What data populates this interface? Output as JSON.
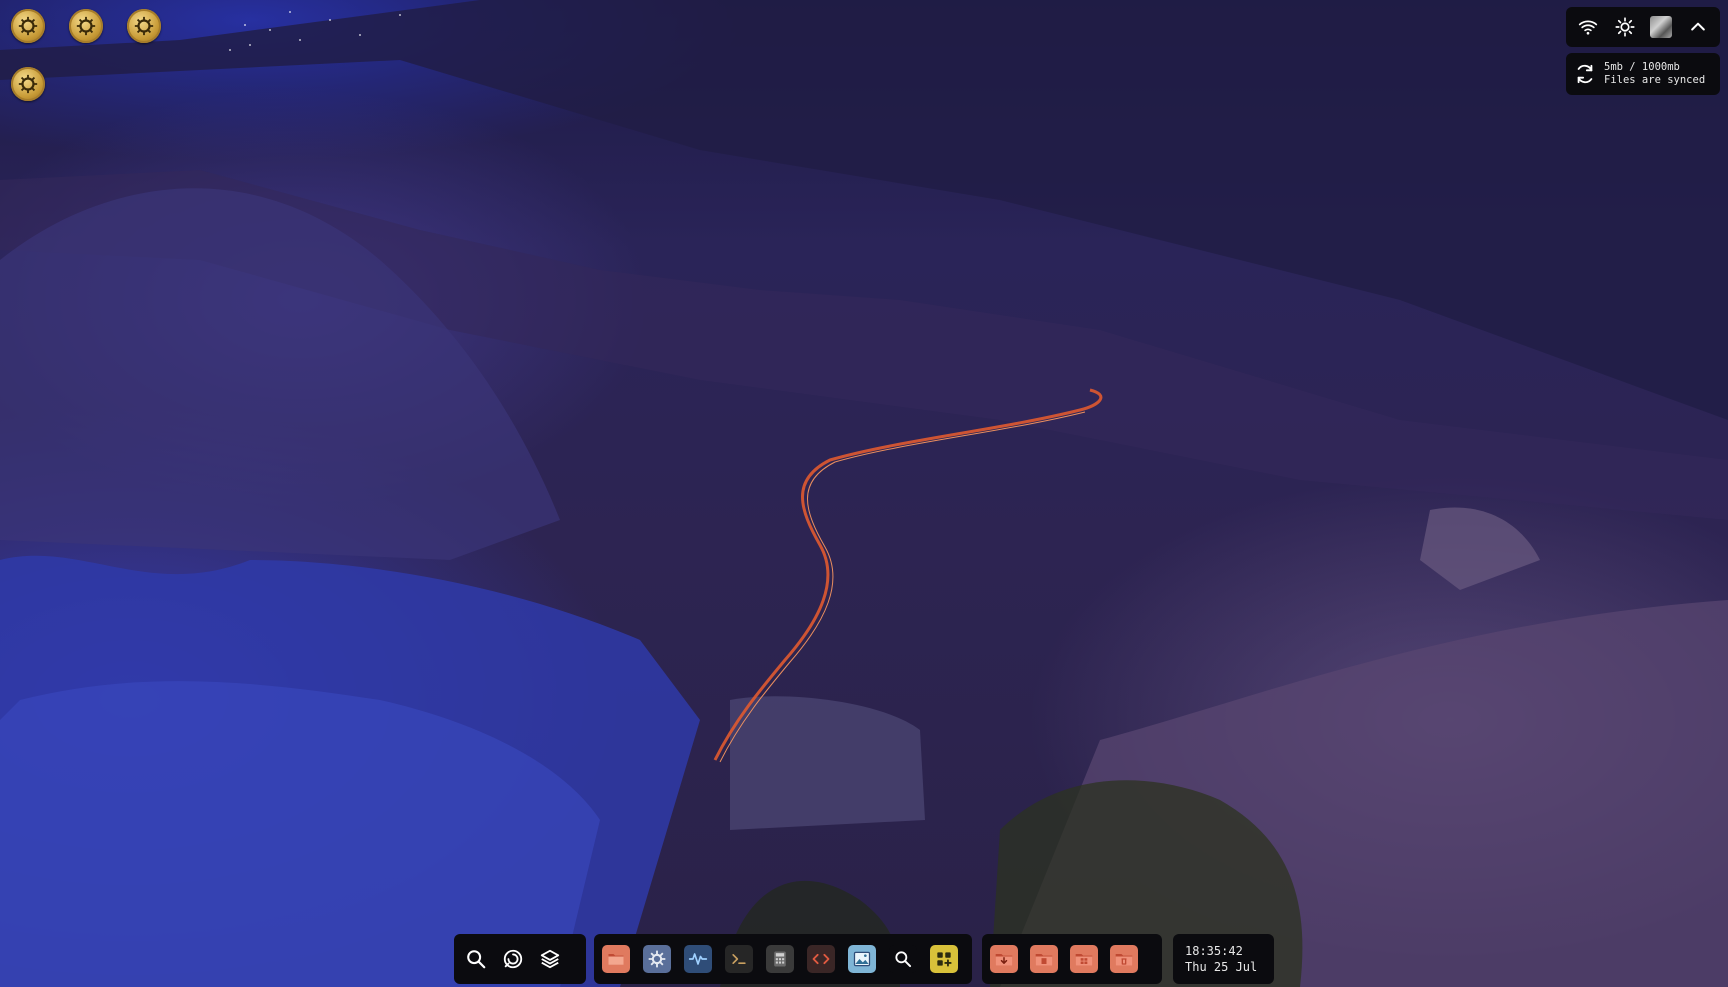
{
  "desktop": {
    "icons": [
      {
        "name": "settings-gear-icon"
      },
      {
        "name": "settings-gear-icon"
      },
      {
        "name": "settings-gear-icon"
      },
      {
        "name": "settings-gear-icon"
      }
    ]
  },
  "top_panel": {
    "icons": [
      "wifi-icon",
      "brightness-icon",
      "user-avatar",
      "chevron-up-icon"
    ]
  },
  "sync_widget": {
    "usage": "5mb / 1000mb",
    "status": "Files are synced",
    "icon": "sync-icon"
  },
  "dock": {
    "launcher": [
      "search-icon",
      "activity-icon",
      "layers-icon"
    ],
    "apps": [
      {
        "name": "files",
        "icon": "folder-icon",
        "color": "#e07a5f"
      },
      {
        "name": "settings",
        "icon": "gear-icon",
        "color": "#5a6f9a"
      },
      {
        "name": "system-monitor",
        "icon": "pulse-icon",
        "color": "#3a5a8a"
      },
      {
        "name": "terminal",
        "icon": "terminal-icon",
        "color": "#2a2a2a"
      },
      {
        "name": "calculator",
        "icon": "calculator-icon",
        "color": "#3a3a3a"
      },
      {
        "name": "code-editor",
        "icon": "code-icon",
        "color": "#3a2a2a"
      },
      {
        "name": "image-viewer",
        "icon": "image-icon",
        "color": "#7fb5d6"
      },
      {
        "name": "search",
        "icon": "search-icon",
        "color": "#0b0b0f"
      },
      {
        "name": "app-store",
        "icon": "apps-add-icon",
        "color": "#d8c13a"
      }
    ],
    "folders": [
      {
        "name": "downloads",
        "icon": "download-folder-icon",
        "color": "#e07a5f"
      },
      {
        "name": "documents",
        "icon": "documents-folder-icon",
        "color": "#e07a5f"
      },
      {
        "name": "apps-folder",
        "icon": "grid-folder-icon",
        "color": "#e07a5f"
      },
      {
        "name": "trash",
        "icon": "trash-folder-icon",
        "color": "#e07a5f"
      }
    ]
  },
  "clock": {
    "time": "18:35:42",
    "date": "Thu 25 Jul"
  }
}
